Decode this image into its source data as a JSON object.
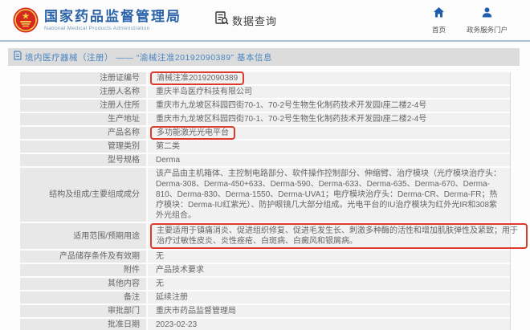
{
  "header": {
    "org_name_cn": "国家药品监督管理局",
    "org_name_en": "National Medical Products Administration",
    "nav_data_query": "数据查询",
    "nav_home": "首页",
    "nav_portal": "政务服务门户"
  },
  "title_bar": {
    "title": "境内医疗器械（注册） —— “渝械注准20192090389” 基本信息"
  },
  "table": {
    "rows": [
      {
        "label": "注册证编号",
        "value": "渝械注准20192090389",
        "highlight": "value"
      },
      {
        "label": "注册人名称",
        "value": "重庆半岛医疗科技有限公司"
      },
      {
        "label": "注册人住所",
        "value": "重庆市九龙坡区科园四街70-1、70-2号生物生化制药技术开发园I座二楼2-4号"
      },
      {
        "label": "生产地址",
        "value": "重庆市九龙坡区科园四街70-1、70-2号生物生化制药技术开发园I座二楼2-4号"
      },
      {
        "label": "产品名称",
        "value": "多功能激光光电平台",
        "highlight": "value"
      },
      {
        "label": "管理类别",
        "value": "第二类"
      },
      {
        "label": "型号规格",
        "value": "Derma"
      },
      {
        "label": "结构及组成/主要组成成分",
        "value": "该产品由主机箱体、主控制电路部分、软件操作控制部分、伸缩臂、治疗模块（光疗模块治疗头：Derma-308、Derma-450+633、Derma-590、Derma-633、Derma-635、Derma-670、Derma-810、Derma-830、Derma-1550、Derma-UVA1；电疗模块治疗头：Derma-CR、Derma-FR；热疗模块：Derma-IU红紫光）、防护眼镜几大部分组成。光电平台的IU治疗模块为红外光IR和308紫外光组合。"
      },
      {
        "label": "适用范围/预期用途",
        "value": "主要适用于镇痛消炎、促进组织修复、促进毛发生长、刺激多种酶的活性和增加肌肤弹性及紧致；用于治疗过敏性皮炎、炎性痤疮、白斑病、白癜风和银屑病。",
        "highlight": "box"
      },
      {
        "label": "产品储存条件及有效期",
        "value": "无"
      },
      {
        "label": "附件",
        "value": "产品技术要求"
      },
      {
        "label": "其他内容",
        "value": "无"
      },
      {
        "label": "备注",
        "value": "延续注册"
      },
      {
        "label": "审批部门",
        "value": "重庆市药品监督管理局"
      },
      {
        "label": "批准日期",
        "value": "2023-02-23"
      }
    ]
  },
  "icons": {
    "national-emblem-icon": "PRC national emblem (red/gold)",
    "data-query-icon": "document with magnifier",
    "home-icon": "house",
    "user-icon": "person",
    "document-icon": "page"
  },
  "colors": {
    "header_blue": "#2a63a7",
    "nav_icon_blue": "#1d5fae",
    "title_text_blue": "#4b86c2",
    "title_bar_bg": "#dcdcdc",
    "label_cell_bg": "#e8e8e8",
    "value_cell_bg": "#f1f1f1",
    "annotation_red": "#dc3a2c",
    "emblem_red": "#d5281e",
    "emblem_gold": "#f7c948"
  }
}
